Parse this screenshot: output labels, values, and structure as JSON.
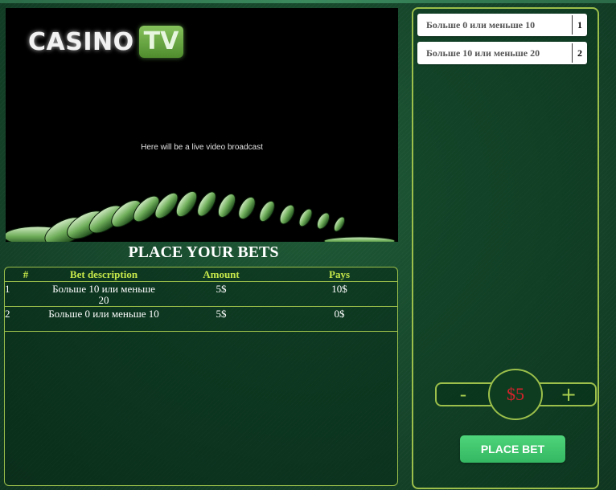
{
  "video": {
    "logo_casino": "CASINO",
    "logo_tv": "TV",
    "caption": "Here will be a live video broadcast"
  },
  "bets": {
    "title": "PLACE YOUR BETS",
    "columns": {
      "num": "#",
      "desc": "Bet description",
      "amount": "Amount",
      "pays": "Pays"
    },
    "rows": [
      {
        "num": "1",
        "desc": "Больше 10 или меньше 20",
        "amount": "5$",
        "pays": "10$"
      },
      {
        "num": "2",
        "desc": "Больше 0 или меньше 10",
        "amount": "5$",
        "pays": "0$"
      }
    ]
  },
  "options": [
    {
      "label": "Больше 0 или меньше 10",
      "num": "1"
    },
    {
      "label": "Больше 10 или меньше 20",
      "num": "2"
    }
  ],
  "stake": {
    "minus": "-",
    "plus": "+",
    "value": "$5"
  },
  "place_bet_label": "PLACE BET",
  "colors": {
    "accent": "#9bbf4a",
    "header_text": "#c6e84a",
    "stake_value": "#d4232a",
    "button": "#3ec46c"
  },
  "icons": {
    "minus": "minus-icon",
    "plus": "plus-icon"
  }
}
